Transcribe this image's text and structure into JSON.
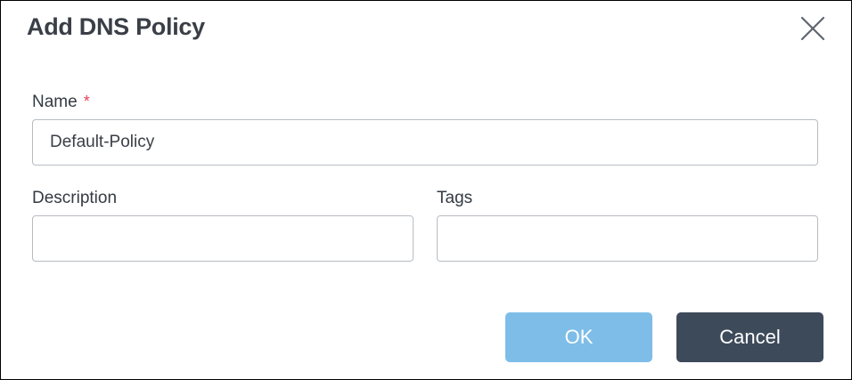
{
  "dialog": {
    "title": "Add DNS Policy",
    "close_icon": "close-icon"
  },
  "form": {
    "name": {
      "label": "Name",
      "required_mark": "*",
      "value": "Default-Policy"
    },
    "description": {
      "label": "Description",
      "value": ""
    },
    "tags": {
      "label": "Tags",
      "value": ""
    }
  },
  "actions": {
    "ok_label": "OK",
    "cancel_label": "Cancel"
  },
  "colors": {
    "ok_button": "#7dbde8",
    "cancel_button": "#3d4a5a",
    "required": "#e0445a",
    "title_text": "#3a3f47"
  }
}
